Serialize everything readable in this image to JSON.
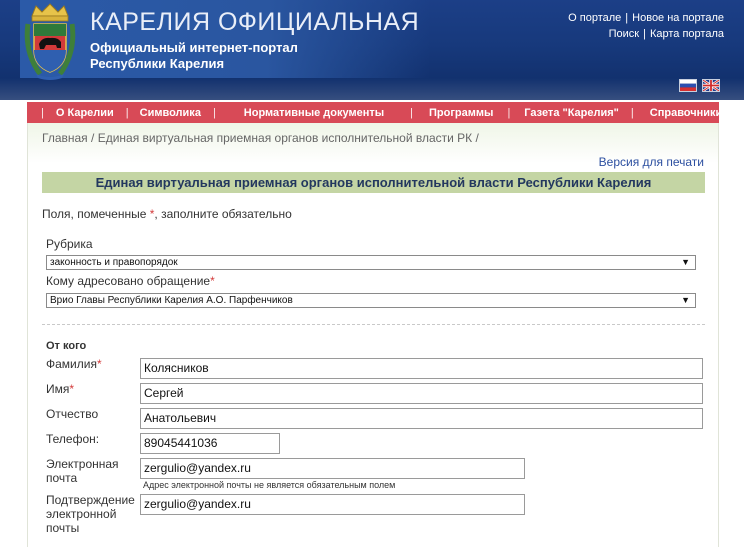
{
  "header": {
    "title": "КАРЕЛИЯ ОФИЦИАЛЬНАЯ",
    "subtitle_line1": "Официальный интернет-портал",
    "subtitle_line2": "Республики Карелия",
    "links": {
      "about": "О портале",
      "news": "Новое на портале",
      "search": "Поиск",
      "sitemap": "Карта портала",
      "separator": "|"
    },
    "flags": [
      "russian-flag-icon",
      "uk-flag-icon"
    ],
    "emblem": "karelia-coat-of-arms-icon"
  },
  "nav": {
    "items": [
      "О Карелии",
      "Символика",
      "Нормативные документы",
      "Программы",
      "Газета \"Карелия\"",
      "Справочники"
    ],
    "separator": "|"
  },
  "breadcrumb": {
    "home": "Главная",
    "current": "Единая виртуальная приемная органов исполнительной власти РК",
    "separator": "/"
  },
  "print_link": "Версия для печати",
  "page_heading": "Единая виртуальная приемная органов исполнительной власти Республики Карелия",
  "required_note": {
    "before": "Поля, помеченные",
    "star": "*",
    "after": ", заполните обязательно"
  },
  "form": {
    "rubric_label": "Рубрика",
    "rubric_value": "законность и правопорядок",
    "addressee_label": "Кому адресовано обращение",
    "addressee_value": "Врио Главы Республики Карелия А.О. Парфенчиков",
    "required_star": "*",
    "section_title": "От кого",
    "surname_label": "Фамилия",
    "surname_value": "Колясников",
    "name_label": "Имя",
    "name_value": "Сергей",
    "patronymic_label": "Отчество",
    "patronymic_value": "Анатольевич",
    "phone_label": "Телефон:",
    "phone_value": "89045441036",
    "email_label_line1": "Электронная",
    "email_label_line2": "почта",
    "email_value": "zergulio@yandex.ru",
    "email_hint": "Адрес электронной почты не является обязательным полем",
    "email_confirm_label_line1": "Подтверждение",
    "email_confirm_label_line2": "электронной",
    "email_confirm_label_line3": "почты",
    "email_confirm_value": "zergulio@yandex.ru",
    "dropdown_arrow": "▼"
  },
  "colors": {
    "header_bg": "#17397c",
    "nav_bg": "#d84a57",
    "heading_bg": "#c4d5a4",
    "required_star": "#d33a3a",
    "link": "#2c4fa0"
  }
}
